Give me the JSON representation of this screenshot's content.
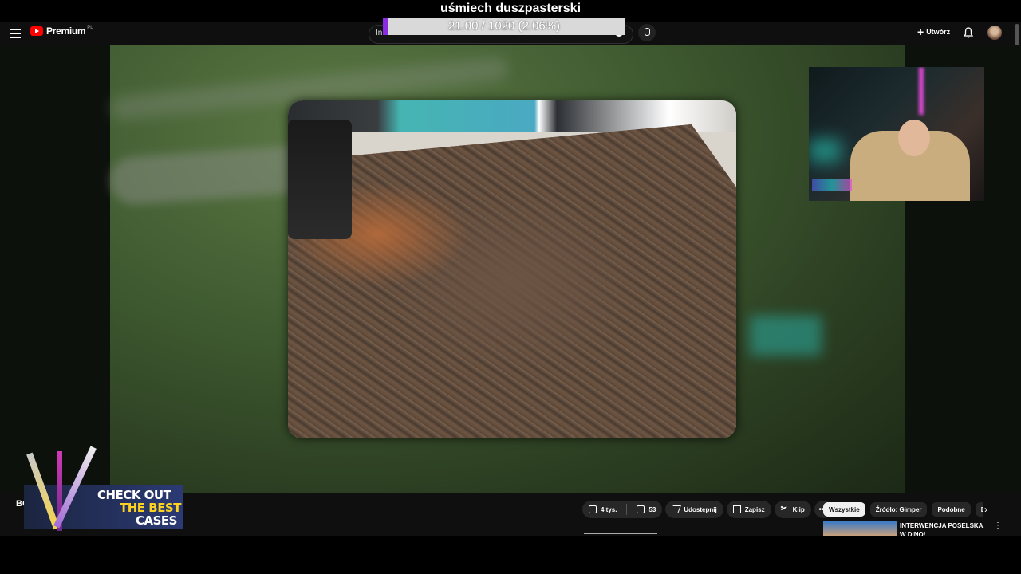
{
  "overlay": {
    "title": "uśmiech duszpasterski",
    "goal_text": "21.00 / 1020 (2.06%)",
    "goal_fraction": 0.0206,
    "goal_fill_color": "#8a2be2"
  },
  "topbar": {
    "logo": "Premium",
    "country": "PL",
    "search_value": "Inb",
    "create_label": "Utwórz"
  },
  "channel": {
    "name_partial": "BO"
  },
  "promo": {
    "line1": "CHECK OUT",
    "line2": "THE BEST",
    "line3": "CASES"
  },
  "actions": {
    "likes": "4 tys.",
    "dislikes": "53",
    "share": "Udostępnij",
    "save": "Zapisz",
    "clip": "Klip"
  },
  "chips": [
    "Wszystkie",
    "Źródło: Gimper",
    "Podobne",
    "Dla"
  ],
  "recommendation": {
    "title": "INTERWENCJA POSELSKA W DINO!"
  },
  "icons": {
    "menu": "hamburger-icon",
    "search": "search-icon",
    "mic": "mic-icon",
    "create": "plus-icon",
    "notifications": "bell-icon",
    "like": "thumbs-up-icon",
    "dislike": "thumbs-down-icon",
    "share": "share-icon",
    "save": "save-icon",
    "clip": "scissors-icon",
    "more": "more-icon",
    "next": "chevron-right-icon"
  }
}
